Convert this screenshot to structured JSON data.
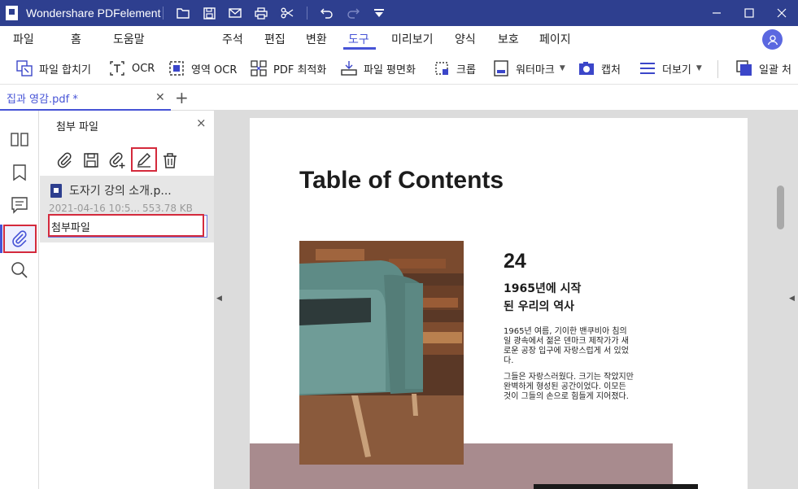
{
  "app": {
    "title": "Wondershare PDFelement"
  },
  "titlebar": {
    "quick_icons": [
      "folder-icon",
      "save-icon",
      "mail-icon",
      "print-icon",
      "scissors-icon",
      "undo-icon",
      "redo-icon",
      "dropdown-icon"
    ],
    "window_controls": [
      "minimize-icon",
      "maximize-icon",
      "close-icon"
    ]
  },
  "menu": {
    "items": [
      "파일",
      "홈",
      "도움말",
      "주석",
      "편집",
      "변환",
      "도구",
      "미리보기",
      "양식",
      "보호",
      "페이지"
    ],
    "active": "도구"
  },
  "toolbar": {
    "items": [
      {
        "label": "파일 합치기",
        "icon": "combine-icon"
      },
      {
        "label": "OCR",
        "icon": "ocr-icon"
      },
      {
        "label": "영역 OCR",
        "icon": "area-ocr-icon"
      },
      {
        "label": "PDF 최적화",
        "icon": "optimize-icon"
      },
      {
        "label": "파일 평면화",
        "icon": "flatten-icon"
      },
      {
        "label": "크롭",
        "icon": "crop-icon"
      },
      {
        "label": "워터마크",
        "icon": "watermark-icon"
      },
      {
        "label": "캡처",
        "icon": "capture-icon"
      },
      {
        "label": "더보기",
        "icon": "more-icon"
      },
      {
        "label": "일괄 처",
        "icon": "batch-icon"
      }
    ]
  },
  "tabs": {
    "document": "집과 영감.pdf *",
    "add": "+"
  },
  "panel": {
    "title": "첨부 파일",
    "close": "×",
    "attachment": {
      "name": "도자기 강의 소개.p...",
      "date": "2021-04-16 10:5...",
      "size": "553.78 KB",
      "description": "첨부파일"
    }
  },
  "page": {
    "title": "Table of Contents",
    "number": "24",
    "subtitle_line1": "1965년에 시작",
    "subtitle_line2": "된 우리의 역사",
    "para1": "1965년 여름, 기이한 밴쿠비아 침의 일 광속에서 젊은 덴마크 제작가가 새로운 공장 입구에 자랑스럽게 서 있었다.",
    "para2": "그들은 자랑스러웠다. 크기는 작았지만 완벽하게 형성된 공간이었다. 이모든 것이 그들의 손으로 힘들게 지어졌다."
  },
  "colors": {
    "titlebar": "#2e3f8f",
    "accent": "#4653d6",
    "highlight": "#d42a3c"
  }
}
